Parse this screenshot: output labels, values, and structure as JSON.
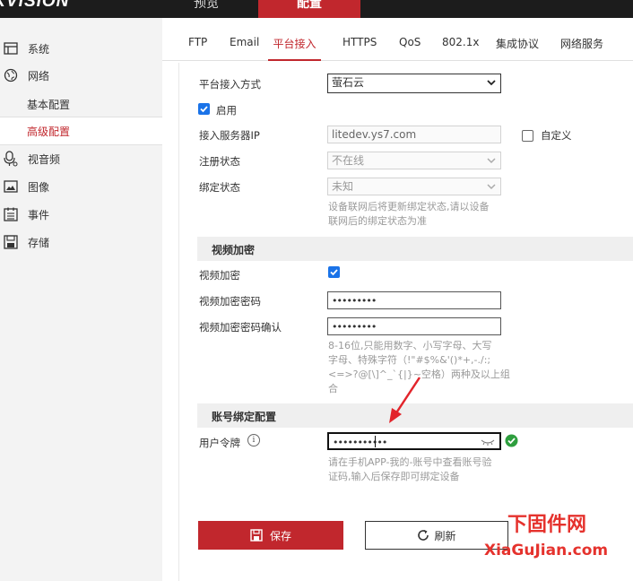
{
  "brand": {
    "logo_text": "IKVISION",
    "mark": "®"
  },
  "top_nav": {
    "preview": "预览",
    "config": "配置"
  },
  "sidebar": {
    "items": [
      {
        "label": "系统",
        "icon": "system-icon"
      },
      {
        "label": "网络",
        "icon": "network-icon"
      },
      {
        "label": "基本配置"
      },
      {
        "label": "高级配置"
      },
      {
        "label": "视音频",
        "icon": "microphone-icon"
      },
      {
        "label": "图像",
        "icon": "image-icon"
      },
      {
        "label": "事件",
        "icon": "event-icon"
      },
      {
        "label": "存储",
        "icon": "storage-icon"
      }
    ]
  },
  "tabs": [
    "FTP",
    "Email",
    "平台接入",
    "HTTPS",
    "QoS",
    "802.1x",
    "集成协议",
    "网络服务"
  ],
  "form": {
    "access_mode_label": "平台接入方式",
    "access_mode_value": "萤石云",
    "enable_label": "启用",
    "server_ip_label": "接入服务器IP",
    "server_ip_value": "litedev.ys7.com",
    "custom_label": "自定义",
    "register_status_label": "注册状态",
    "register_status_value": "不在线",
    "bind_status_label": "绑定状态",
    "bind_status_value": "未知",
    "bind_hint_line1": "设备联网后将更新绑定状态,请以设备",
    "bind_hint_line2": "联网后的绑定状态为准"
  },
  "video_encryption": {
    "section_title": "视频加密",
    "encrypt_label": "视频加密",
    "password_label": "视频加密密码",
    "password_value": "•••••••••",
    "confirm_label": "视频加密密码确认",
    "confirm_value": "•••••••••",
    "hint_line1": "8-16位,只能用数字、小写字母、大写",
    "hint_line2": "字母、特殊字符（!\"#$%&'()*+,-./:;",
    "hint_line3": "<=>?@[\\]^_`{|}~空格）两种及以上组",
    "hint_line4": "合"
  },
  "account_binding": {
    "section_title": "账号绑定配置",
    "token_label": "用户令牌",
    "token_value": "•••••••••••",
    "hint_line1": "请在手机APP-我的-账号中查看账号验",
    "hint_line2": "证码,输入后保存即可绑定设备"
  },
  "buttons": {
    "save": "保存",
    "refresh": "刷新"
  },
  "watermark": {
    "top": "下固件网",
    "bottom": "XiaGuJian.com"
  },
  "colors": {
    "accent": "#c1272d",
    "checkbox": "#1a73e8",
    "valid": "#2e9e3e",
    "annotation": "#e2242b"
  }
}
